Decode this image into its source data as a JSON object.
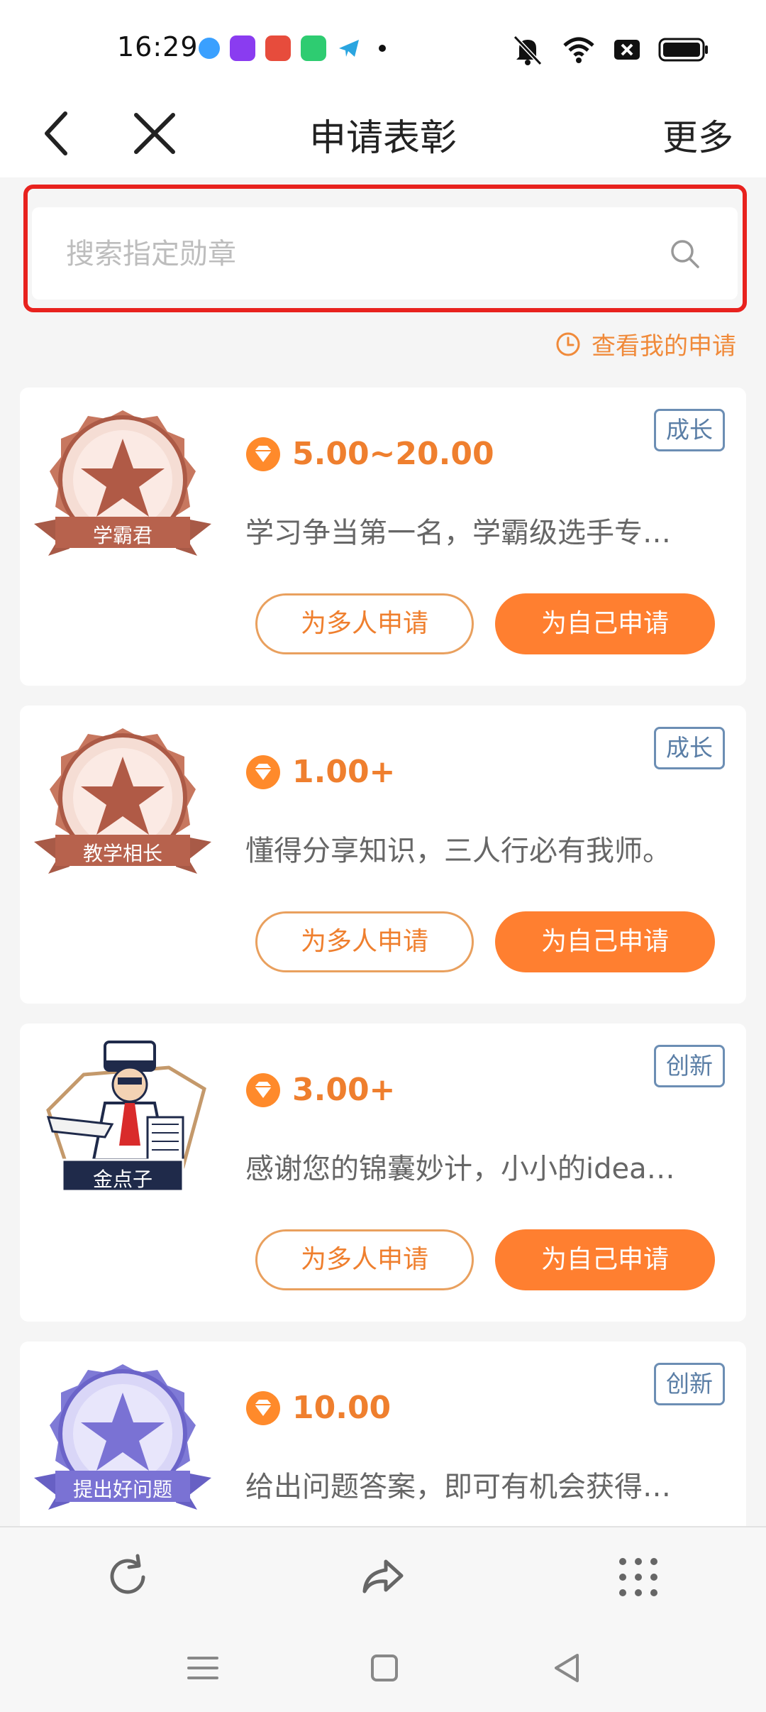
{
  "status": {
    "time": "16:29",
    "apps": [
      {
        "icon": "app-icon-blue",
        "color": "#3aa0ff"
      },
      {
        "icon": "app-icon-purple",
        "color": "#8a3cf0"
      },
      {
        "icon": "app-icon-red",
        "color": "#e74c3c"
      },
      {
        "icon": "app-icon-green",
        "color": "#2ecc71"
      },
      {
        "icon": "app-icon-telegram",
        "color": "#2aa5e0"
      }
    ]
  },
  "header": {
    "title": "申请表彰",
    "more": "更多"
  },
  "search": {
    "placeholder": "搜索指定勋章"
  },
  "my_apply": "查看我的申请",
  "cards": [
    {
      "badge_label": "学霸君",
      "price": "5.00~20.00",
      "desc": "学习争当第一名，学霸级选手专…",
      "tag": "成长",
      "btn_multi": "为多人申请",
      "btn_self": "为自己申请"
    },
    {
      "badge_label": "教学相长",
      "price": "1.00+",
      "desc": "懂得分享知识，三人行必有我师。",
      "tag": "成长",
      "btn_multi": "为多人申请",
      "btn_self": "为自己申请"
    },
    {
      "badge_label": "金点子",
      "price": "3.00+",
      "desc": "感谢您的锦囊妙计，小小的idea…",
      "tag": "创新",
      "btn_multi": "为多人申请",
      "btn_self": "为自己申请"
    },
    {
      "badge_label": "提出好问题",
      "price": "10.00",
      "desc": "给出问题答案，即可有机会获得…",
      "tag": "创新"
    }
  ],
  "colors": {
    "accent": "#ff7f30",
    "tag": "#5a7ea6",
    "highlight": "#e8221e"
  }
}
